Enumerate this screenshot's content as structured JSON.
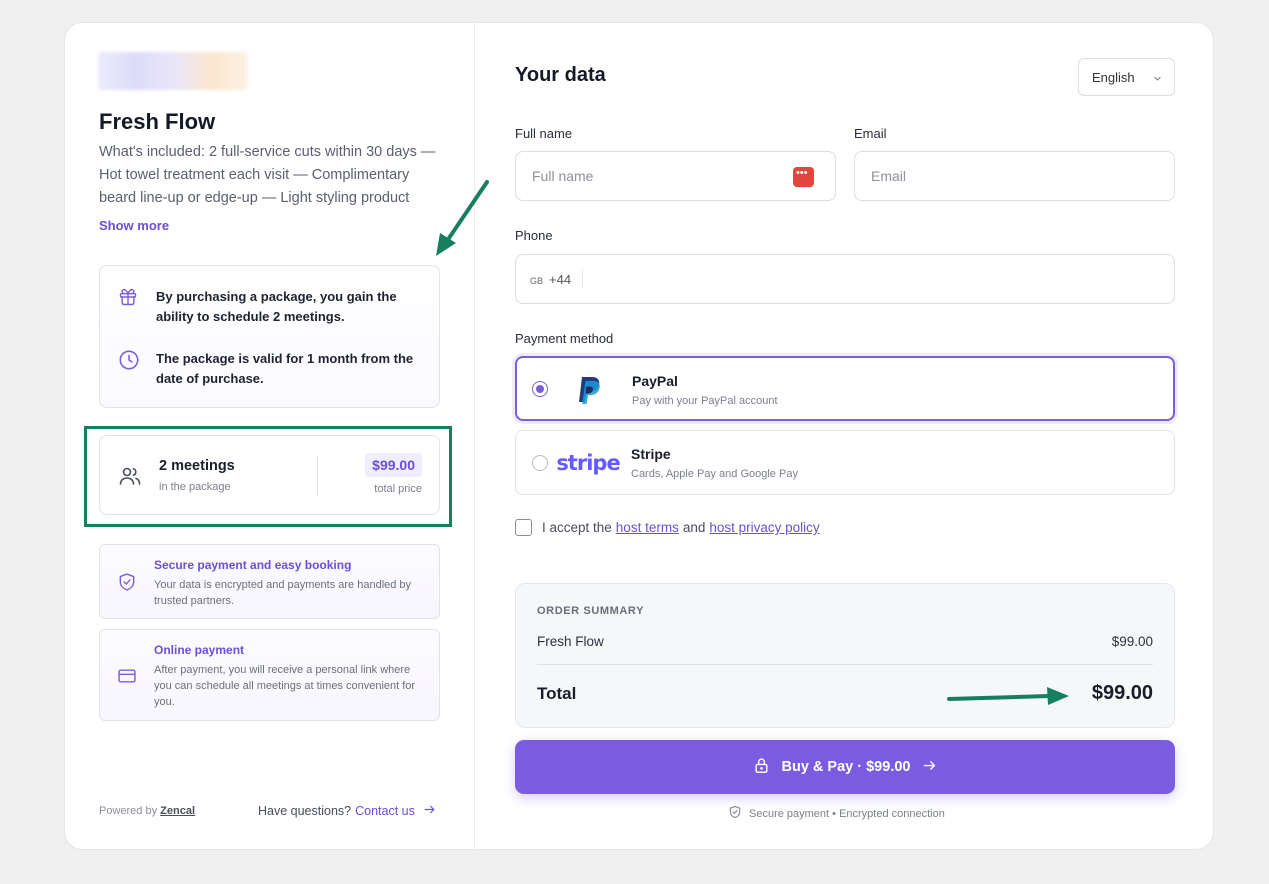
{
  "product": {
    "title": "Fresh Flow",
    "description": "What's included: 2 full-service cuts within 30 days — Hot towel treatment each visit — Complimentary beard line-up or edge-up — Light styling product",
    "show_more": "Show more"
  },
  "package_info": {
    "meetings_note": "By purchasing a package, you gain the ability to schedule 2 meetings.",
    "validity_note": "The package is valid for 1 month from the date of purchase."
  },
  "package_summary": {
    "meetings": "2 meetings",
    "meetings_sub": "in the package",
    "price": "$99.00",
    "price_sub": "total price"
  },
  "features": [
    {
      "title": "Secure payment and easy booking",
      "text": "Your data is encrypted and payments are handled by trusted partners."
    },
    {
      "title": "Online payment",
      "text": "After payment, you will receive a personal link where you can schedule all meetings at times convenient for you."
    }
  ],
  "footer": {
    "powered_by": "Powered by",
    "brand": "Zencal",
    "questions": "Have questions?",
    "contact": "Contact us"
  },
  "form": {
    "title": "Your data",
    "language": "English",
    "full_name_label": "Full name",
    "full_name_placeholder": "Full name",
    "email_label": "Email",
    "email_placeholder": "Email",
    "phone_label": "Phone",
    "phone_country": "GB",
    "phone_code": "+44",
    "payment_label": "Payment method"
  },
  "payment_methods": [
    {
      "name": "PayPal",
      "sub": "Pay with your PayPal account",
      "selected": true
    },
    {
      "name": "Stripe",
      "sub": "Cards, Apple Pay and Google Pay",
      "logo_text": "stripe",
      "selected": false
    }
  ],
  "terms": {
    "prefix": "I accept the",
    "terms_link": "host terms",
    "and": "and",
    "privacy_link": "host privacy policy"
  },
  "order_summary": {
    "heading": "ORDER SUMMARY",
    "item_name": "Fresh Flow",
    "item_price": "$99.00",
    "total_label": "Total",
    "total_price": "$99.00"
  },
  "buy_button": {
    "label": "Buy & Pay · $99.00"
  },
  "secure_note": "Secure payment • Encrypted connection",
  "colors": {
    "accent": "#7b5ce0",
    "highlight": "#177e5f",
    "link": "#6b4fd4"
  }
}
